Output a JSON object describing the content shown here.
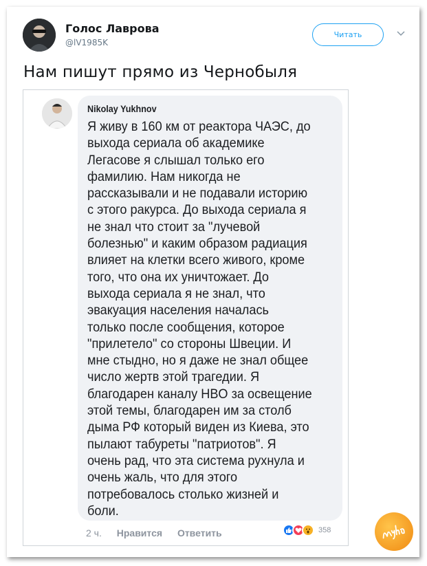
{
  "tweet": {
    "author_name": "Голос Лаврова",
    "author_handle": "@lV1985K",
    "follow_label": "Читать",
    "text": "Нам пишут прямо из Чернобыля"
  },
  "embedded_comment": {
    "name": "Nikolay Yukhnov",
    "body": "Я живу в 160 км от реактора ЧАЭС, до\nвыхода сериала об академике\nЛегасове я слышал только его\nфамилию. Нам никогда не\nрассказывали и не подавали историю\nс этого ракурса. До выхода сериала я\nне знал что стоит за \"лучевой\nболезнью\" и каким образом радиация\nвлияет на клетки всего живого, кроме\nтого, что она их уничтожает. До\nвыхода сериала я не знал, что\nэвакуация населения началась\nтолько после сообщения, которое\n\"прилетело\" со стороны Швеции. И\nмне стыдно, но я даже не знал общее\nчисло жертв этой трагедии. Я\nблагодарен каналу HBO за освещение\nэтой темы, благодарен им за столб\nдыма РФ который виден из Киева, это\nпылают табуреты \"патриотов\". Я\nочень рад, что эта система рухнула и\nочень жаль, что для этого\nпотребовалось столько жизней и\nболи.",
    "time": "2 ч.",
    "like_label": "Нравится",
    "reply_label": "Ответить",
    "reaction_count": "358",
    "reactions": [
      "like-icon",
      "love-icon",
      "wow-icon"
    ]
  },
  "watermark": {
    "text": "Nyka"
  },
  "colors": {
    "twitter_blue": "#1da1f2",
    "fb_bubble": "#f0f2f5",
    "fb_like": "#1877f2",
    "fb_love": "#f33e58",
    "fb_wow": "#f7b125",
    "watermark_orange": "#f08a12"
  }
}
